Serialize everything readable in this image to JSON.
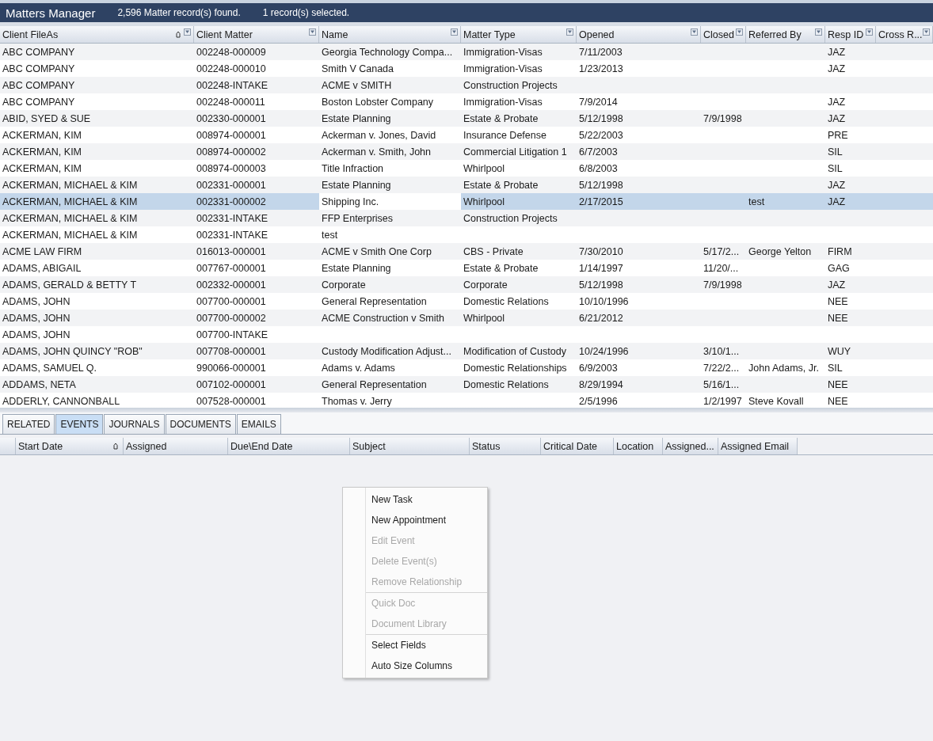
{
  "title_bar": {
    "title": "Matters Manager",
    "record_count": "2,596 Matter record(s) found.",
    "selection_count": "1 record(s) selected."
  },
  "matters_grid": {
    "columns": [
      {
        "label": "Client FileAs",
        "sorted": true,
        "current": false
      },
      {
        "label": "Client Matter",
        "sorted": false,
        "current": false
      },
      {
        "label": "Name",
        "sorted": false,
        "current": true
      },
      {
        "label": "Matter Type",
        "sorted": false,
        "current": false
      },
      {
        "label": "Opened",
        "sorted": false,
        "current": false
      },
      {
        "label": "Closed",
        "sorted": false,
        "current": false
      },
      {
        "label": "Referred By",
        "sorted": false,
        "current": false
      },
      {
        "label": "Resp ID",
        "sorted": false,
        "current": false
      },
      {
        "label": "Cross R...",
        "sorted": false,
        "current": false
      }
    ],
    "rows": [
      {
        "selected": false,
        "cells": [
          "ABC COMPANY",
          "002248-000009",
          "Georgia Technology Compa...",
          "Immigration-Visas",
          "7/11/2003",
          null,
          null,
          "JAZ",
          null
        ]
      },
      {
        "selected": false,
        "cells": [
          "ABC COMPANY",
          "002248-000010",
          "Smith V Canada",
          "Immigration-Visas",
          "1/23/2013",
          null,
          null,
          "JAZ",
          null
        ]
      },
      {
        "selected": false,
        "cells": [
          "ABC COMPANY",
          "002248-INTAKE",
          "ACME v SMITH",
          "Construction Projects",
          null,
          null,
          null,
          null,
          null
        ]
      },
      {
        "selected": false,
        "cells": [
          "ABC COMPANY",
          "002248-000011",
          "Boston Lobster Company",
          "Immigration-Visas",
          "7/9/2014",
          null,
          null,
          "JAZ",
          null
        ]
      },
      {
        "selected": false,
        "cells": [
          "ABID, SYED & SUE",
          "002330-000001",
          "Estate Planning",
          "Estate & Probate",
          "5/12/1998",
          "7/9/1998",
          null,
          "JAZ",
          null
        ]
      },
      {
        "selected": false,
        "cells": [
          "ACKERMAN, KIM",
          "008974-000001",
          "Ackerman v. Jones, David",
          "Insurance Defense",
          "5/22/2003",
          null,
          null,
          "PRE",
          null
        ]
      },
      {
        "selected": false,
        "cells": [
          "ACKERMAN, KIM",
          "008974-000002",
          "Ackerman v. Smith, John",
          "Commercial Litigation  1",
          "6/7/2003",
          null,
          null,
          "SIL",
          null
        ]
      },
      {
        "selected": false,
        "cells": [
          "ACKERMAN, KIM",
          "008974-000003",
          "Title Infraction",
          "Whirlpool",
          "6/8/2003",
          null,
          null,
          "SIL",
          null
        ]
      },
      {
        "selected": false,
        "cells": [
          "ACKERMAN, MICHAEL & KIM",
          "002331-000001",
          "Estate Planning",
          "Estate & Probate",
          "5/12/1998",
          null,
          null,
          "JAZ",
          null
        ]
      },
      {
        "selected": true,
        "cells": [
          "ACKERMAN, MICHAEL & KIM",
          "002331-000002",
          "Shipping Inc.",
          "Whirlpool",
          "2/17/2015",
          null,
          "test",
          "JAZ",
          null
        ]
      },
      {
        "selected": false,
        "cells": [
          "ACKERMAN, MICHAEL & KIM",
          "002331-INTAKE",
          "FFP Enterprises",
          "Construction Projects",
          null,
          null,
          null,
          null,
          null
        ]
      },
      {
        "selected": false,
        "cells": [
          "ACKERMAN, MICHAEL & KIM",
          "002331-INTAKE",
          "test",
          null,
          null,
          null,
          null,
          null,
          null
        ]
      },
      {
        "selected": false,
        "cells": [
          "ACME LAW FIRM",
          "016013-000001",
          "ACME v Smith One Corp",
          "CBS - Private",
          "7/30/2010",
          "5/17/2...",
          "George Yelton",
          "FIRM",
          null
        ]
      },
      {
        "selected": false,
        "cells": [
          "ADAMS, ABIGAIL",
          "007767-000001",
          "Estate Planning",
          "Estate & Probate",
          "1/14/1997",
          "11/20/...",
          null,
          "GAG",
          null
        ]
      },
      {
        "selected": false,
        "cells": [
          "ADAMS, GERALD & BETTY  T",
          "002332-000001",
          "Corporate",
          "Corporate",
          "5/12/1998",
          "7/9/1998",
          null,
          "JAZ",
          null
        ]
      },
      {
        "selected": false,
        "cells": [
          "ADAMS, JOHN",
          "007700-000001",
          "General Representation",
          "Domestic Relations",
          "10/10/1996",
          null,
          null,
          "NEE",
          null
        ]
      },
      {
        "selected": false,
        "cells": [
          "ADAMS, JOHN",
          "007700-000002",
          "ACME Construction v Smith",
          "Whirlpool",
          "6/21/2012",
          null,
          null,
          "NEE",
          null
        ]
      },
      {
        "selected": false,
        "cells": [
          "ADAMS, JOHN",
          "007700-INTAKE",
          null,
          null,
          null,
          null,
          null,
          null,
          null
        ]
      },
      {
        "selected": false,
        "cells": [
          "ADAMS, JOHN QUINCY \"ROB\"",
          "007708-000001",
          "Custody Modification Adjust...",
          "Modification of Custody",
          "10/24/1996",
          "3/10/1...",
          null,
          "WUY",
          null
        ]
      },
      {
        "selected": false,
        "cells": [
          "ADAMS, SAMUEL Q.",
          "990066-000001",
          "Adams v. Adams",
          "Domestic Relationships",
          "6/9/2003",
          "7/22/2...",
          "John Adams, Jr.",
          "SIL",
          null
        ]
      },
      {
        "selected": false,
        "cells": [
          "ADDAMS, NETA",
          "007102-000001",
          "General Representation",
          "Domestic Relations",
          "8/29/1994",
          "5/16/1...",
          null,
          "NEE",
          null
        ]
      },
      {
        "selected": false,
        "cells": [
          "ADDERLY, CANNONBALL",
          "007528-000001",
          "Thomas v. Jerry",
          null,
          "2/5/1996",
          "1/2/1997",
          "Steve Kovall",
          "NEE",
          null
        ]
      }
    ]
  },
  "tabs": [
    {
      "label": "RELATED",
      "selected": false
    },
    {
      "label": "EVENTS",
      "selected": true
    },
    {
      "label": "JOURNALS",
      "selected": false
    },
    {
      "label": "DOCUMENTS",
      "selected": false
    },
    {
      "label": "EMAILS",
      "selected": false
    }
  ],
  "events_grid": {
    "columns": [
      {
        "label": "Start Date",
        "sorted": true
      },
      {
        "label": "Assigned",
        "sorted": false
      },
      {
        "label": "Due\\End Date",
        "sorted": false
      },
      {
        "label": "Subject",
        "sorted": false
      },
      {
        "label": "Status",
        "sorted": false
      },
      {
        "label": "Critical Date",
        "sorted": false
      },
      {
        "label": "Location",
        "sorted": false
      },
      {
        "label": "Assigned...",
        "sorted": false
      },
      {
        "label": "Assigned Email",
        "sorted": false
      }
    ]
  },
  "context_menu": {
    "items": [
      {
        "kind": "item",
        "label": "New Task",
        "disabled": false
      },
      {
        "kind": "item",
        "label": "New Appointment",
        "disabled": false
      },
      {
        "kind": "item",
        "label": "Edit Event",
        "disabled": true
      },
      {
        "kind": "item",
        "label": "Delete Event(s)",
        "disabled": true
      },
      {
        "kind": "item",
        "label": "Remove Relationship",
        "disabled": true
      },
      {
        "kind": "separator"
      },
      {
        "kind": "item",
        "label": "Quick Doc",
        "disabled": true
      },
      {
        "kind": "item",
        "label": "Document Library",
        "disabled": true
      },
      {
        "kind": "separator"
      },
      {
        "kind": "item",
        "label": "Select Fields",
        "disabled": false
      },
      {
        "kind": "item",
        "label": "Auto Size Columns",
        "disabled": false
      }
    ]
  }
}
